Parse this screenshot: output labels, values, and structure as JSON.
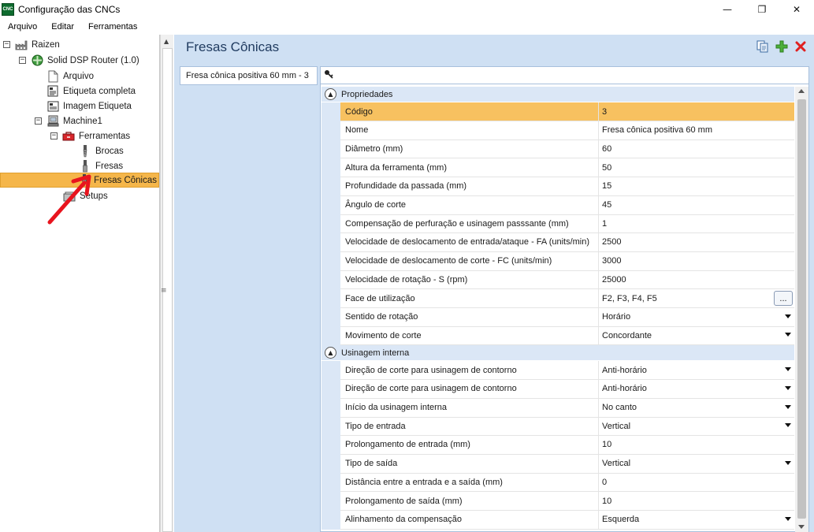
{
  "window": {
    "icon_text": "CNC",
    "title": "Configuração das CNCs",
    "minimize_glyph": "—",
    "maximize_glyph": "❐",
    "close_glyph": "✕"
  },
  "menu": [
    "Arquivo",
    "Editar",
    "Ferramentas"
  ],
  "tree": {
    "root": "Raizen",
    "router": "Solid DSP Router (1.0)",
    "arquivo": "Arquivo",
    "etiqueta_completa": "Etiqueta completa",
    "imagem_etiqueta": "Imagem Etiqueta",
    "machine": "Machine1",
    "ferramentas": "Ferramentas",
    "brocas": "Brocas",
    "fresas": "Fresas",
    "fresas_conicas": "Fresas Cônicas",
    "setups": "Setups"
  },
  "main": {
    "title": "Fresas Cônicas",
    "tool_item": "Fresa cônica positiva 60 mm - 3"
  },
  "grid": {
    "categories": {
      "propriedades": "Propriedades",
      "usinagem_interna": "Usinagem interna"
    },
    "propriedades": [
      {
        "name": "Código",
        "value": "3"
      },
      {
        "name": "Nome",
        "value": "Fresa cônica positiva 60 mm"
      },
      {
        "name": "Diâmetro (mm)",
        "value": "60"
      },
      {
        "name": "Altura da ferramenta (mm)",
        "value": "50"
      },
      {
        "name": "Profundidade da passada (mm)",
        "value": "15"
      },
      {
        "name": "Ângulo de corte",
        "value": "45"
      },
      {
        "name": "Compensação de perfuração e usinagem passsante (mm)",
        "value": "1"
      },
      {
        "name": "Velocidade de deslocamento de entrada/ataque - FA (units/min)",
        "value": "2500"
      },
      {
        "name": "Velocidade de deslocamento de corte - FC (units/min)",
        "value": "3000"
      },
      {
        "name": "Velocidade de rotação - S (rpm)",
        "value": "25000"
      },
      {
        "name": "Face de utilização",
        "value": "F2, F3, F4, F5"
      },
      {
        "name": "Sentido de rotação",
        "value": "Horário"
      },
      {
        "name": "Movimento de corte",
        "value": "Concordante"
      }
    ],
    "usinagem_interna": [
      {
        "name": "Direção de corte para usinagem de contorno",
        "value": "Anti-horário"
      },
      {
        "name": "Direção de corte para usinagem de contorno",
        "value": "Anti-horário"
      },
      {
        "name": "Início da usinagem interna",
        "value": "No canto"
      },
      {
        "name": "Tipo de entrada",
        "value": "Vertical"
      },
      {
        "name": "Prolongamento de entrada (mm)",
        "value": "10"
      },
      {
        "name": "Tipo de saída",
        "value": "Vertical"
      },
      {
        "name": "Distância entre a entrada e a saída (mm)",
        "value": "0"
      },
      {
        "name": "Prolongamento de saída (mm)",
        "value": "10"
      },
      {
        "name": "Alinhamento da compensação",
        "value": "Esquerda"
      }
    ],
    "ellipsis": "..."
  },
  "colors": {
    "selection": "#f7c160",
    "tree_selection": "#f5b64a",
    "panel_blue": "#cfe0f3",
    "category_blue": "#dbe7f6",
    "annotation_red": "#e8141e"
  }
}
